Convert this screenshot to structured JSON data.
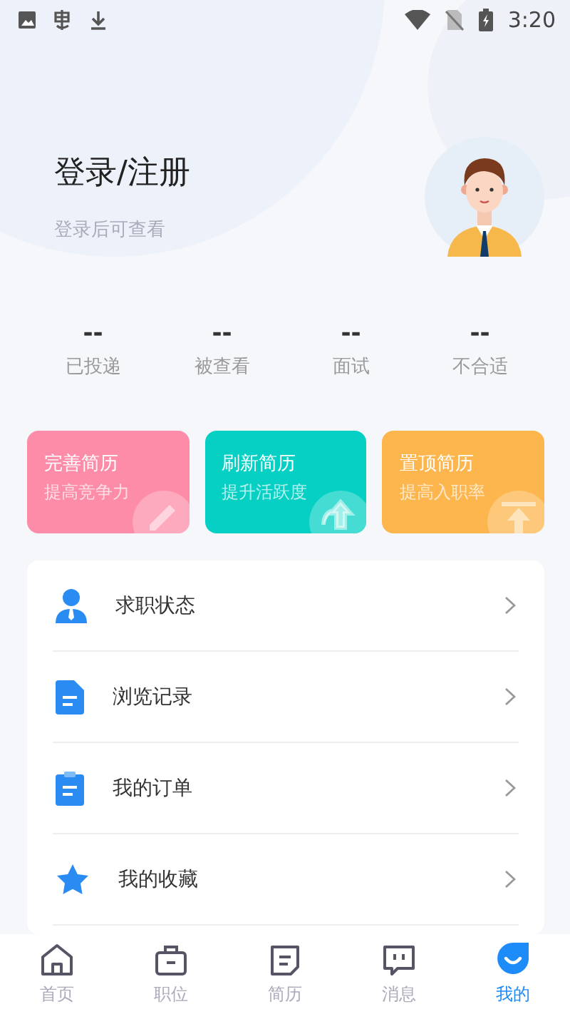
{
  "status_bar": {
    "time": "3:20"
  },
  "profile": {
    "title": "登录/注册",
    "subtitle": "登录后可查看"
  },
  "stats": [
    {
      "value": "--",
      "label": "已投递"
    },
    {
      "value": "--",
      "label": "被查看"
    },
    {
      "value": "--",
      "label": "面试"
    },
    {
      "value": "--",
      "label": "不合适"
    }
  ],
  "action_cards": [
    {
      "title": "完善简历",
      "subtitle": "提高竞争力",
      "color": "#fd8ca8",
      "kind": "pencil"
    },
    {
      "title": "刷新简历",
      "subtitle": "提升活跃度",
      "color": "#06d0c4",
      "kind": "refresh"
    },
    {
      "title": "置顶简历",
      "subtitle": "提高入职率",
      "color": "#fdb64e",
      "kind": "top"
    }
  ],
  "menu": [
    {
      "label": "求职状态",
      "kind": "person"
    },
    {
      "label": "浏览记录",
      "kind": "document"
    },
    {
      "label": "我的订单",
      "kind": "clipboard"
    },
    {
      "label": "我的收藏",
      "kind": "star"
    }
  ],
  "tabs": [
    {
      "label": "首页",
      "kind": "home",
      "selected": false
    },
    {
      "label": "职位",
      "kind": "briefcase",
      "selected": false
    },
    {
      "label": "简历",
      "kind": "resume",
      "selected": false
    },
    {
      "label": "消息",
      "kind": "message",
      "selected": false
    },
    {
      "label": "我的",
      "kind": "me",
      "selected": true
    }
  ]
}
